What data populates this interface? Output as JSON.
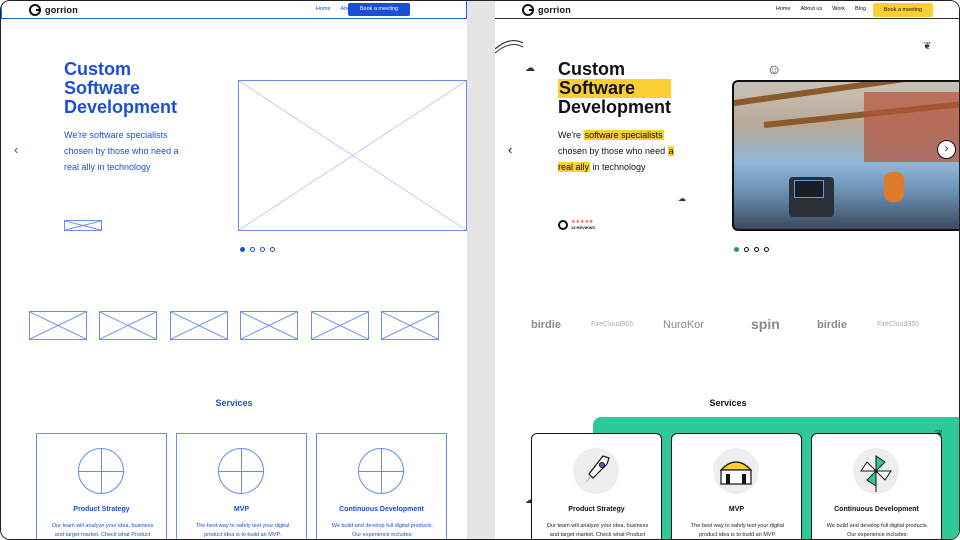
{
  "nav": {
    "logo": "gorrion",
    "links": [
      "Home",
      "About us",
      "Work",
      "Blog"
    ],
    "cta": "Book a meeting"
  },
  "hero": {
    "title_line1": "Custom",
    "title_line2": "Software",
    "title_line3": "Development",
    "sub_part1": "We're ",
    "sub_hl1": "software specialists",
    "sub_part2": " chosen by those who need ",
    "sub_hl2": "a real ally",
    "sub_part3": " in technology",
    "sub_full": "We're software specialists chosen by those who need a real ally in technology",
    "prev_arrow": "‹",
    "next_arrow": "›",
    "reviews": "13 REVIEWS",
    "stars": "★★★★★"
  },
  "brands": [
    "birdie",
    "FireCloud365",
    "NuroKor",
    "spin",
    "birdie",
    "FireCloud365"
  ],
  "services": {
    "title": "Services",
    "cards": [
      {
        "title": "Product Strategy",
        "desc1": "Our team will analyze your idea, business",
        "desc2": "and target market. Check what Product"
      },
      {
        "title": "MVP",
        "desc1": "The best way to safely test your digital",
        "desc2": "product idea is to build an MVP."
      },
      {
        "title": "Continuous Development",
        "desc1": "We build and develop full digital products.",
        "desc2": "Our experience includes:"
      }
    ]
  },
  "colors": {
    "wire_blue": "#1d4ed8",
    "highlight": "#fbcf33",
    "green": "#2fc899"
  }
}
